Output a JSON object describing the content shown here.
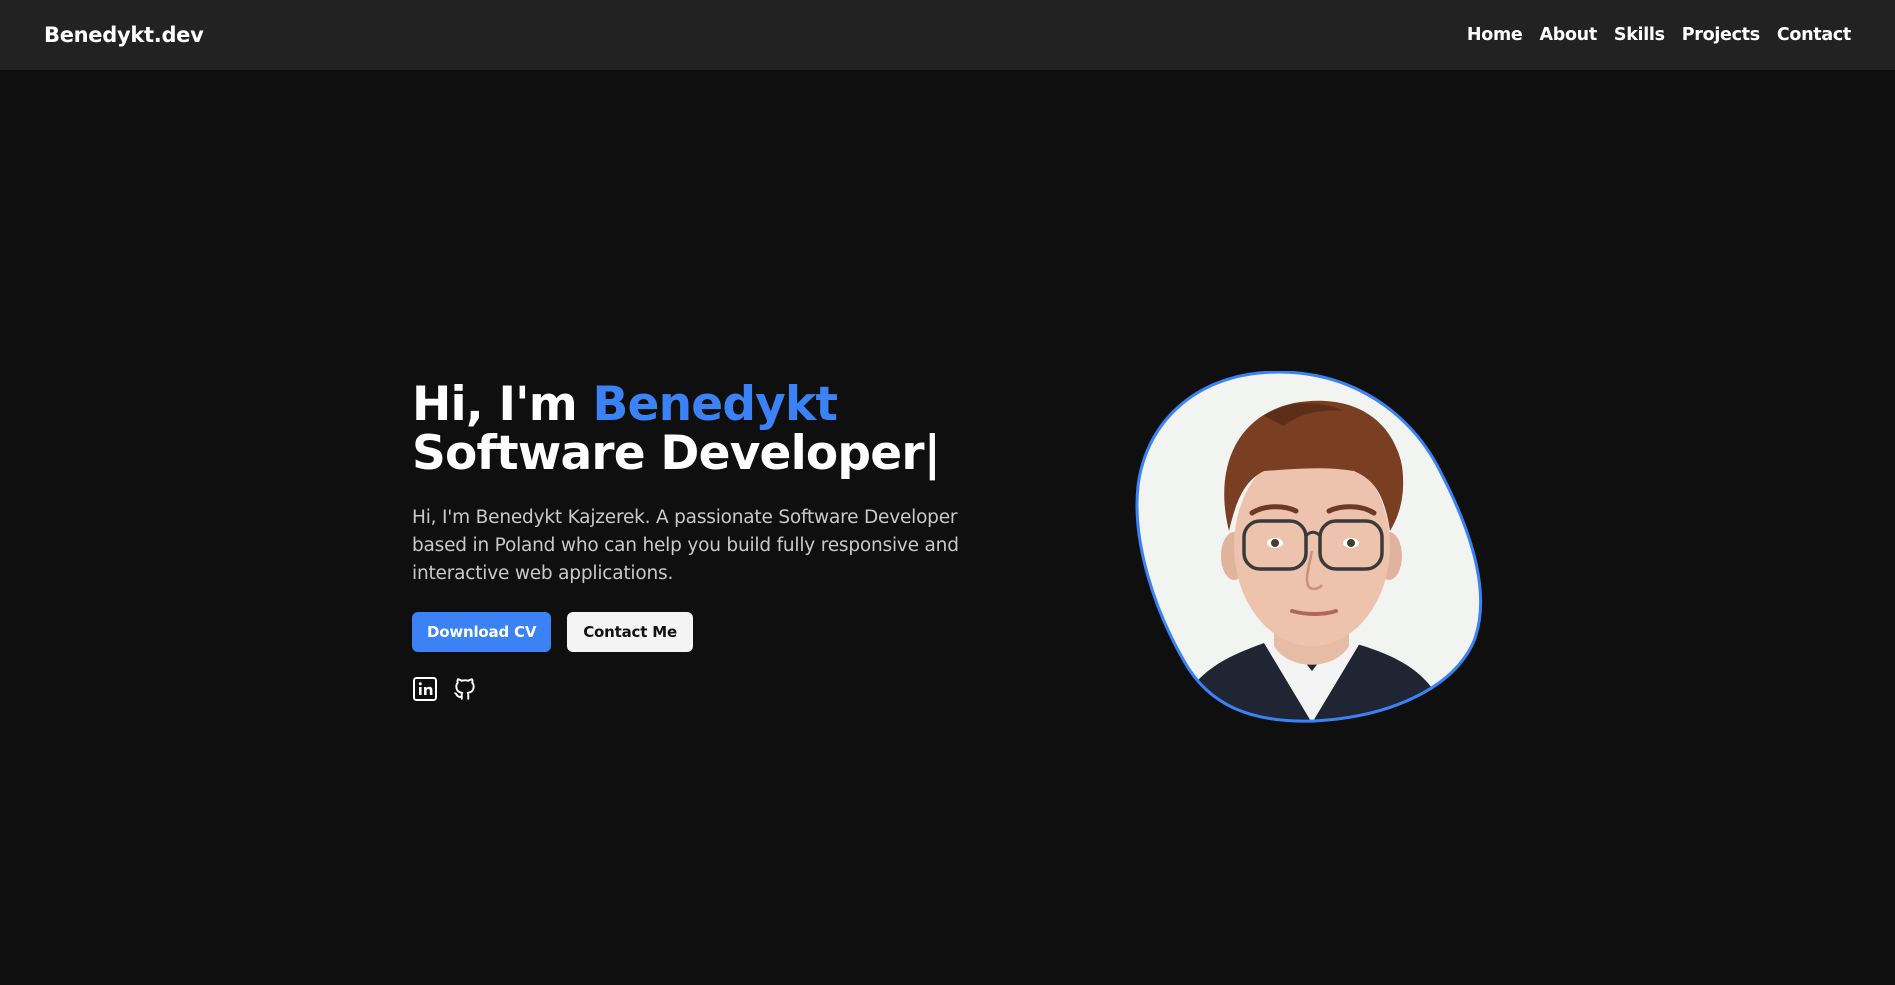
{
  "nav": {
    "logo": "Benedykt.dev",
    "links": [
      "Home",
      "About",
      "Skills",
      "Projects",
      "Contact"
    ]
  },
  "hero": {
    "greeting": "Hi, I'm ",
    "name": "Benedykt",
    "role": "Software Developer",
    "cursor": "|",
    "intro": "Hi, I'm Benedykt Kajzerek. A passionate Software Developer based in Poland who can help you build fully responsive and interactive web applications.",
    "download_cv": "Download CV",
    "contact_me": "Contact Me"
  },
  "socials": [
    {
      "icon": "linkedin-icon"
    },
    {
      "icon": "github-icon"
    }
  ],
  "colors": {
    "accent": "#3b82f6",
    "background": "#0f0f10",
    "navbar": "#222222"
  }
}
